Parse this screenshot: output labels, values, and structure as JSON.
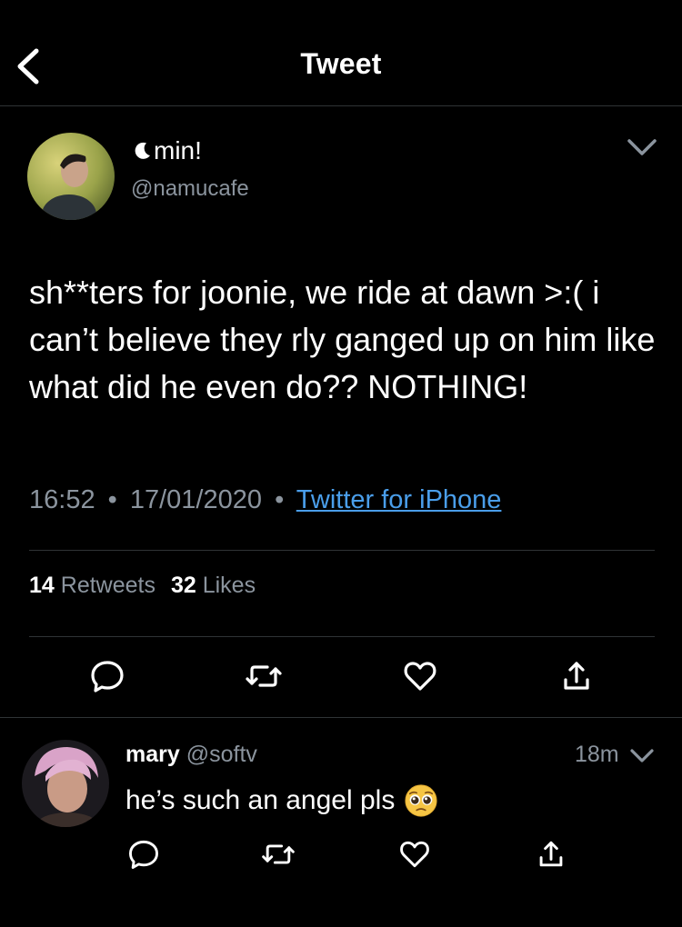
{
  "header": {
    "title": "Tweet"
  },
  "tweet": {
    "display_name": "min!",
    "handle": "@namucafe",
    "text": "sh**ters for joonie, we ride at dawn >:( i can’t believe they rly ganged up on him like what did he even do?? NOTHING!",
    "time": "16:52",
    "date": "17/01/2020",
    "source": "Twitter for iPhone",
    "separator": "•",
    "retweet_count": "14",
    "retweet_label": "Retweets",
    "like_count": "32",
    "like_label": "Likes"
  },
  "reply": {
    "display_name": "mary",
    "handle": "@softv",
    "time": "18m",
    "text": "he’s such an angel pls"
  },
  "colors": {
    "link": "#4a9eea",
    "muted": "#8b949e",
    "divider": "#2f3336"
  }
}
